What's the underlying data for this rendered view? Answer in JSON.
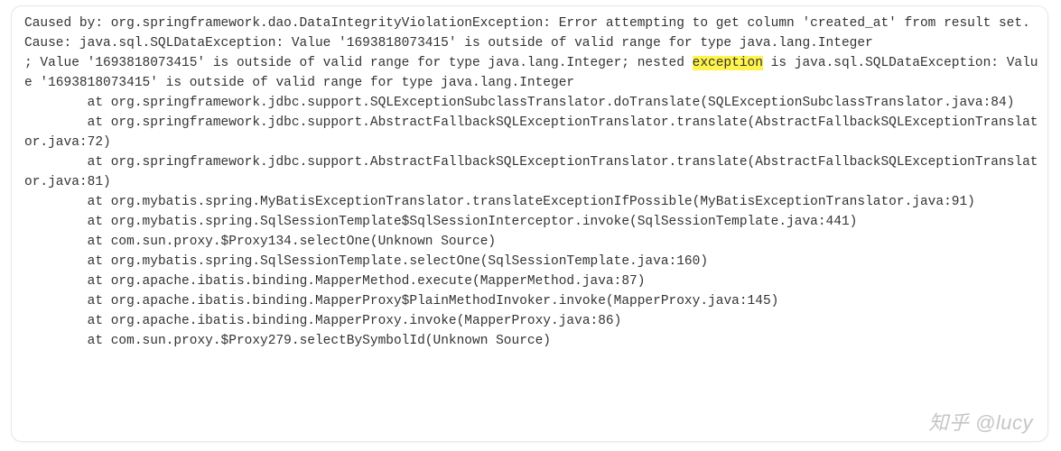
{
  "log": {
    "header_before": "Caused by: org.springframework.dao.DataIntegrityViolationException: Error attempting to get column 'created_at' from result set.  Cause: java.sql.SQLDataException: Value '1693818073415' is outside of valid range for type java.lang.Integer\n; Value '1693818073415' is outside of valid range for type java.lang.Integer; nested ",
    "highlight": "exception",
    "header_after": " is java.sql.SQLDataException: Value '1693818073415' is outside of valid range for type java.lang.Integer",
    "frames": [
      "        at org.springframework.jdbc.support.SQLExceptionSubclassTranslator.doTranslate(SQLExceptionSubclassTranslator.java:84)",
      "        at org.springframework.jdbc.support.AbstractFallbackSQLExceptionTranslator.translate(AbstractFallbackSQLExceptionTranslator.java:72)",
      "        at org.springframework.jdbc.support.AbstractFallbackSQLExceptionTranslator.translate(AbstractFallbackSQLExceptionTranslator.java:81)",
      "        at org.mybatis.spring.MyBatisExceptionTranslator.translateExceptionIfPossible(MyBatisExceptionTranslator.java:91)",
      "        at org.mybatis.spring.SqlSessionTemplate$SqlSessionInterceptor.invoke(SqlSessionTemplate.java:441)",
      "        at com.sun.proxy.$Proxy134.selectOne(Unknown Source)",
      "        at org.mybatis.spring.SqlSessionTemplate.selectOne(SqlSessionTemplate.java:160)",
      "        at org.apache.ibatis.binding.MapperMethod.execute(MapperMethod.java:87)",
      "        at org.apache.ibatis.binding.MapperProxy$PlainMethodInvoker.invoke(MapperProxy.java:145)",
      "        at org.apache.ibatis.binding.MapperProxy.invoke(MapperProxy.java:86)",
      "        at com.sun.proxy.$Proxy279.selectBySymbolId(Unknown Source)"
    ]
  },
  "watermark": "知乎 @lucy"
}
